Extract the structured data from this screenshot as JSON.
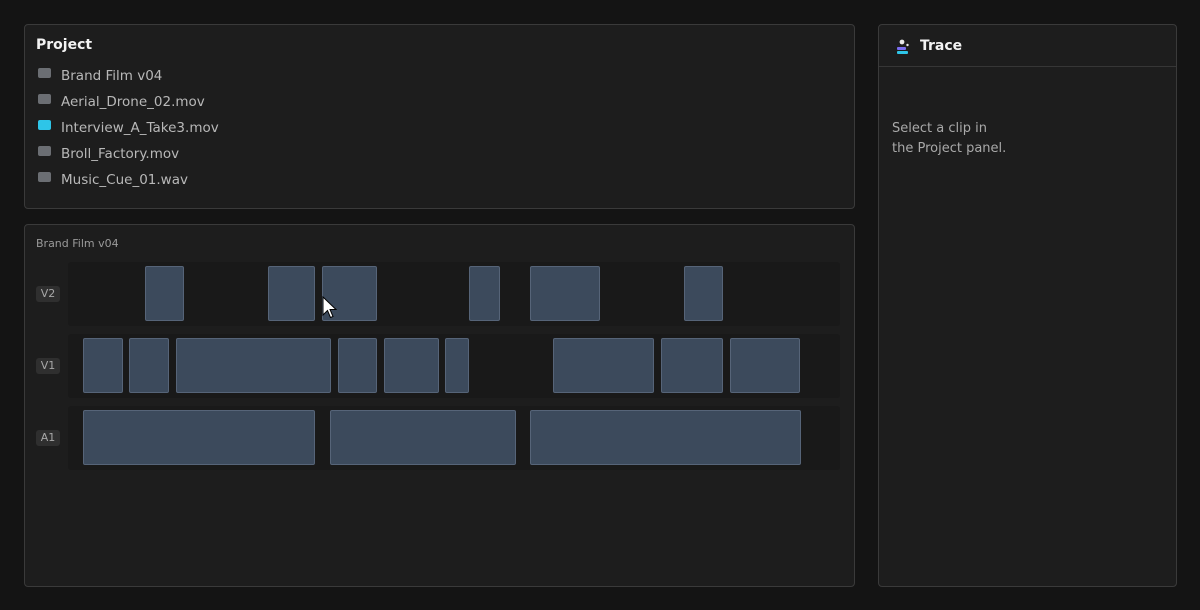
{
  "project": {
    "title": "Project",
    "items": [
      {
        "label": "Brand Film v04",
        "active": false
      },
      {
        "label": "Aerial_Drone_02.mov",
        "active": false
      },
      {
        "label": "Interview_A_Take3.mov",
        "active": true
      },
      {
        "label": "Broll_Factory.mov",
        "active": false
      },
      {
        "label": "Music_Cue_01.wav",
        "active": false
      }
    ]
  },
  "timeline": {
    "name": "Brand Film v04",
    "tracks": [
      {
        "label": "V2",
        "clip_count": 6
      },
      {
        "label": "V1",
        "clip_count": 9
      },
      {
        "label": "A1",
        "clip_count": 3
      }
    ]
  },
  "trace": {
    "title": "Trace",
    "message_line1": "Select a clip in",
    "message_line2": "the Project panel."
  },
  "colors": {
    "accent": "#2ec5e8",
    "clip_fill": "#3c4a5c",
    "clip_border": "#566478",
    "panel_bg": "#1d1d1d",
    "page_bg": "#141414"
  },
  "icons": {
    "trace": "trace-icon",
    "cursor": "mouse-pointer-icon"
  }
}
